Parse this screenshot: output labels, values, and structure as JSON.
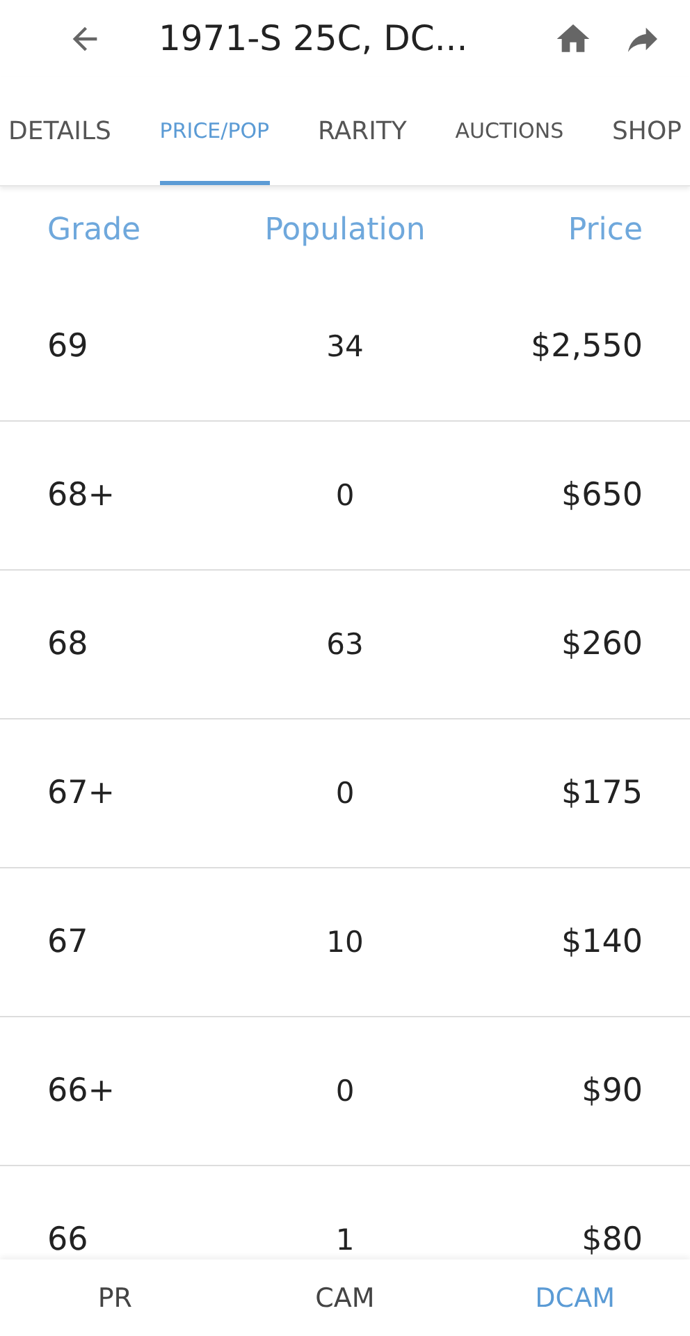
{
  "header": {
    "title": "1971-S 25C, DC..."
  },
  "tabs": [
    {
      "label": "DETAILS",
      "selected": false,
      "kind": "regular"
    },
    {
      "label": "PRICE/POP",
      "selected": true,
      "kind": "compact"
    },
    {
      "label": "RARITY",
      "selected": false,
      "kind": "regular"
    },
    {
      "label": "AUCTIONS",
      "selected": false,
      "kind": "compact"
    },
    {
      "label": "SHOP",
      "selected": false,
      "kind": "regular"
    }
  ],
  "table": {
    "columns": [
      "Grade",
      "Population",
      "Price"
    ],
    "rows": [
      {
        "grade": "69",
        "population": "34",
        "price": "$2,550"
      },
      {
        "grade": "68+",
        "population": "0",
        "price": "$650"
      },
      {
        "grade": "68",
        "population": "63",
        "price": "$260"
      },
      {
        "grade": "67+",
        "population": "0",
        "price": "$175"
      },
      {
        "grade": "67",
        "population": "10",
        "price": "$140"
      },
      {
        "grade": "66+",
        "population": "0",
        "price": "$90"
      },
      {
        "grade": "66",
        "population": "1",
        "price": "$80"
      }
    ]
  },
  "bottom_tabs": [
    {
      "label": "PR",
      "selected": false
    },
    {
      "label": "CAM",
      "selected": false
    },
    {
      "label": "DCAM",
      "selected": true
    }
  ]
}
